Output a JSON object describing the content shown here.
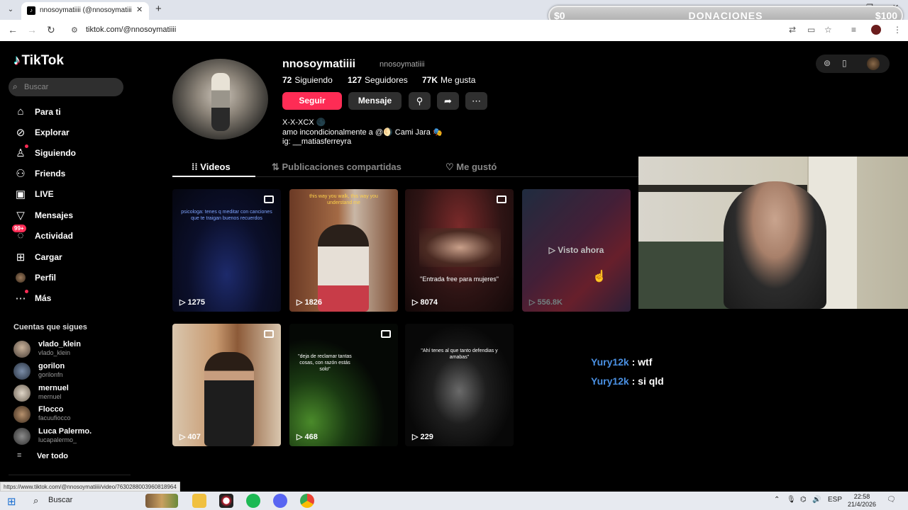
{
  "browser": {
    "tab_title": "nnosoymatiiii (@nnosoymatiiii)",
    "url_text": "tiktok.com/@nnosoymatiiii",
    "status_url": "https://www.tiktok.com/@nnosoymatiiii/video/7630288003960818964"
  },
  "donations": {
    "left": "$0",
    "center": "DONACIONES",
    "right": "$100"
  },
  "sidebar": {
    "logo": "TikTok",
    "search_placeholder": "Buscar",
    "items": [
      {
        "label": "Para ti",
        "icon": "home-icon"
      },
      {
        "label": "Explorar",
        "icon": "compass-icon"
      },
      {
        "label": "Siguiendo",
        "icon": "following-icon"
      },
      {
        "label": "Friends",
        "icon": "friends-icon"
      },
      {
        "label": "LIVE",
        "icon": "live-icon"
      },
      {
        "label": "Mensajes",
        "icon": "messages-icon"
      },
      {
        "label": "Actividad",
        "icon": "activity-icon",
        "badge": "99+"
      },
      {
        "label": "Cargar",
        "icon": "upload-icon"
      },
      {
        "label": "Perfil",
        "icon": "profile-icon"
      },
      {
        "label": "Más",
        "icon": "more-icon"
      }
    ],
    "following_header": "Cuentas que sigues",
    "accounts": [
      {
        "name": "vlado_klein",
        "user": "vlado_klein"
      },
      {
        "name": "gorilon",
        "user": "gorilonfn"
      },
      {
        "name": "mernuel",
        "user": "mernuel"
      },
      {
        "name": "Flocco",
        "user": "facuufiocco"
      },
      {
        "name": "Luca Palermo.",
        "user": "lucapalermo_"
      }
    ],
    "see_all": "Ver todo"
  },
  "profile": {
    "username": "nnosoymatiiii",
    "nickname": "nnosoymatiiii",
    "following_count": "72",
    "following_label": "Siguiendo",
    "followers_count": "127",
    "followers_label": "Seguidores",
    "likes_count": "77K",
    "likes_label": "Me gusta",
    "follow_btn": "Seguir",
    "message_btn": "Mensaje",
    "bio": [
      "X-X-XCX 🌑",
      "amo incondicionalmente a @🌖 Cami Jara 🎭",
      "ig: __matiasferreyra"
    ]
  },
  "tabs": [
    {
      "label": "Videos",
      "icon": "grid-icon"
    },
    {
      "label": "Publicaciones compartidas",
      "icon": "repost-icon"
    },
    {
      "label": "Me gustó",
      "icon": "heart-outline-icon"
    }
  ],
  "videos": [
    {
      "views": "1275",
      "caption": "psicologa: tenes q meditar con canciones que te traigan buenos recuerdos",
      "multi": true
    },
    {
      "views": "1826",
      "caption": "this way you walk, this way you understand me",
      "multi": false
    },
    {
      "views": "8074",
      "caption": "\"Entrada free para mujeres\"",
      "multi": true
    },
    {
      "views": "556.8K",
      "caption": "",
      "multi": false,
      "watched": "Visto ahora"
    },
    {
      "views": "407",
      "caption": "",
      "multi": true
    },
    {
      "views": "468",
      "caption": "\"deja de reclamar tantas cosas, con razón estás solo\"",
      "multi": true
    },
    {
      "views": "229",
      "caption": "\"Ahí tenes al que tanto defendias y amabas\"",
      "multi": false
    }
  ],
  "chat": [
    {
      "user": "Yury12k",
      "msg": ": wtf"
    },
    {
      "user": "Yury12k",
      "msg": ": si qld"
    }
  ],
  "taskbar": {
    "search": "Buscar",
    "lang": "ESP",
    "time": "22:58",
    "date": "21/4/2026"
  },
  "colors": {
    "accent": "#fe2c55",
    "chat_user": "#4a90e2",
    "background": "#000000"
  }
}
